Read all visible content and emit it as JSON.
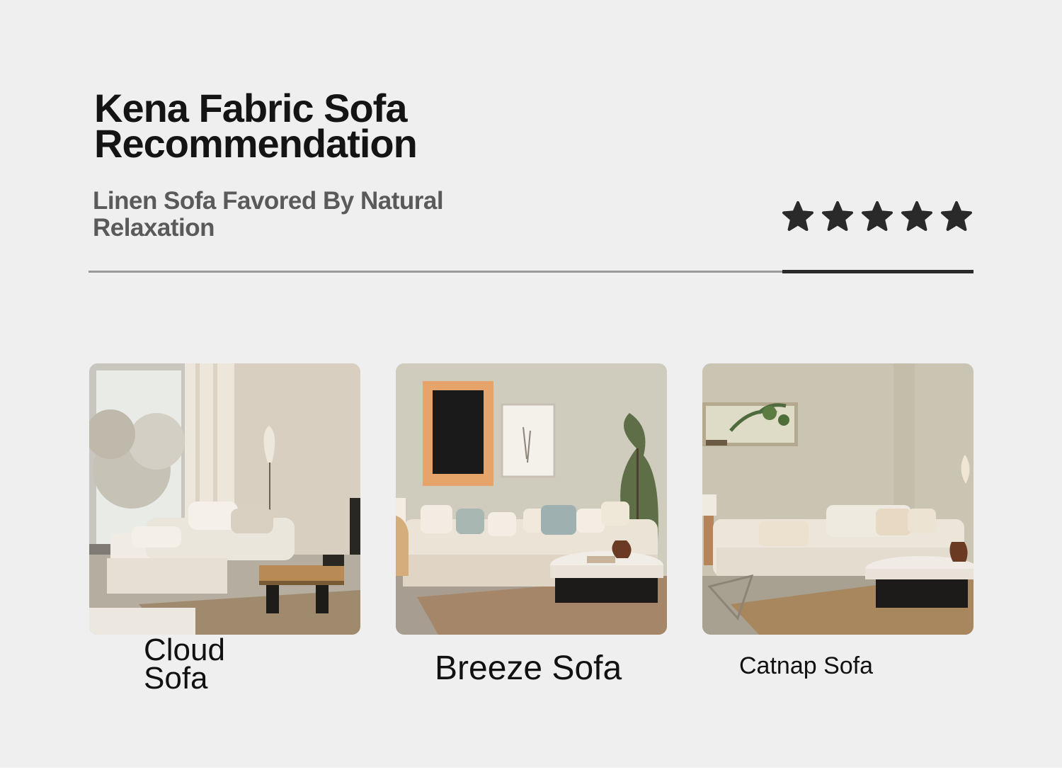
{
  "header": {
    "title": "Kena Fabric Sofa Recommendation",
    "subtitle": "Linen Sofa Favored By Natural Relaxation"
  },
  "rating": {
    "value": 5,
    "max": 5,
    "icon": "star-icon",
    "color": "#2a2a2a"
  },
  "products": [
    {
      "name": "Cloud Sofa",
      "image": "living room with modular white fabric sofa, window and floor lamp"
    },
    {
      "name": "Breeze Sofa",
      "image": "living room with slipcovered linen sofa, wall art and plant"
    },
    {
      "name": "Catnap Sofa",
      "image": "living room with white linen sofa, round coffee table and wall niche"
    }
  ],
  "colors": {
    "background": "#efefef",
    "title": "#141414",
    "subtitle": "#5a5a5a",
    "divider": "#9a9a9a",
    "divider_accent": "#2a2a2a"
  }
}
